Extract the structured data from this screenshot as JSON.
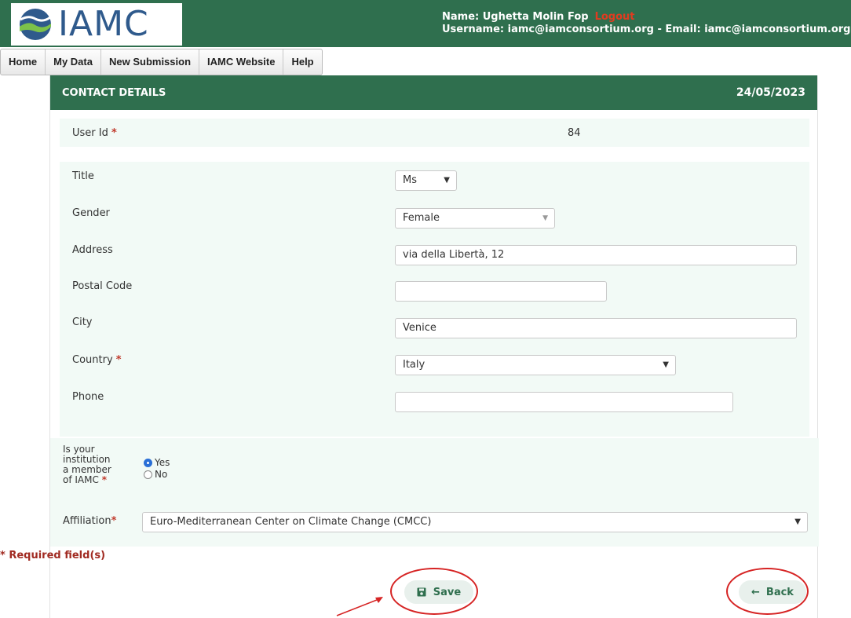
{
  "header": {
    "logo_text": "IAMC",
    "user_name_line": "Name: Ughetta Molin Fop",
    "logout_label": "Logout",
    "username_line": "Username: iamc@iamconsortium.org - Email: iamc@iamconsortium.org"
  },
  "nav": {
    "home": "Home",
    "my_data": "My Data",
    "new_submission": "New Submission",
    "iamc_website": "IAMC Website",
    "help": "Help"
  },
  "panel": {
    "title": "CONTACT DETAILS",
    "date": "24/05/2023"
  },
  "form": {
    "user_id_label": "User Id",
    "user_id_value": "84",
    "title_label": "Title",
    "title_value": "Ms",
    "gender_label": "Gender",
    "gender_value": "Female",
    "address_label": "Address",
    "address_value": "via della Libertà, 12",
    "postal_code_label": "Postal Code",
    "postal_code_value": "",
    "city_label": "City",
    "city_value": "Venice",
    "country_label": "Country",
    "country_value": "Italy",
    "phone_label": "Phone",
    "phone_value": "",
    "member_label_1": "Is your",
    "member_label_2": "institution",
    "member_label_3": "a member",
    "member_label_4": "of IAMC",
    "member_yes": "Yes",
    "member_no": "No",
    "member_selected": "Yes",
    "affiliation_label": "Affiliation",
    "affiliation_value": "Euro-Mediterranean Center on Climate Change (CMCC)",
    "required_asterisk": "*",
    "required_note": "* Required field(s)"
  },
  "buttons": {
    "save_label": "Save",
    "back_label": "Back",
    "save_icon": "floppy-disk-icon",
    "back_icon": "arrow-left-icon"
  },
  "annotations": {
    "highlight_color": "#d62424"
  },
  "colors": {
    "brand_green": "#2f6f4e",
    "form_box_bg": "#f2faf6",
    "required_red": "#a12b22"
  }
}
